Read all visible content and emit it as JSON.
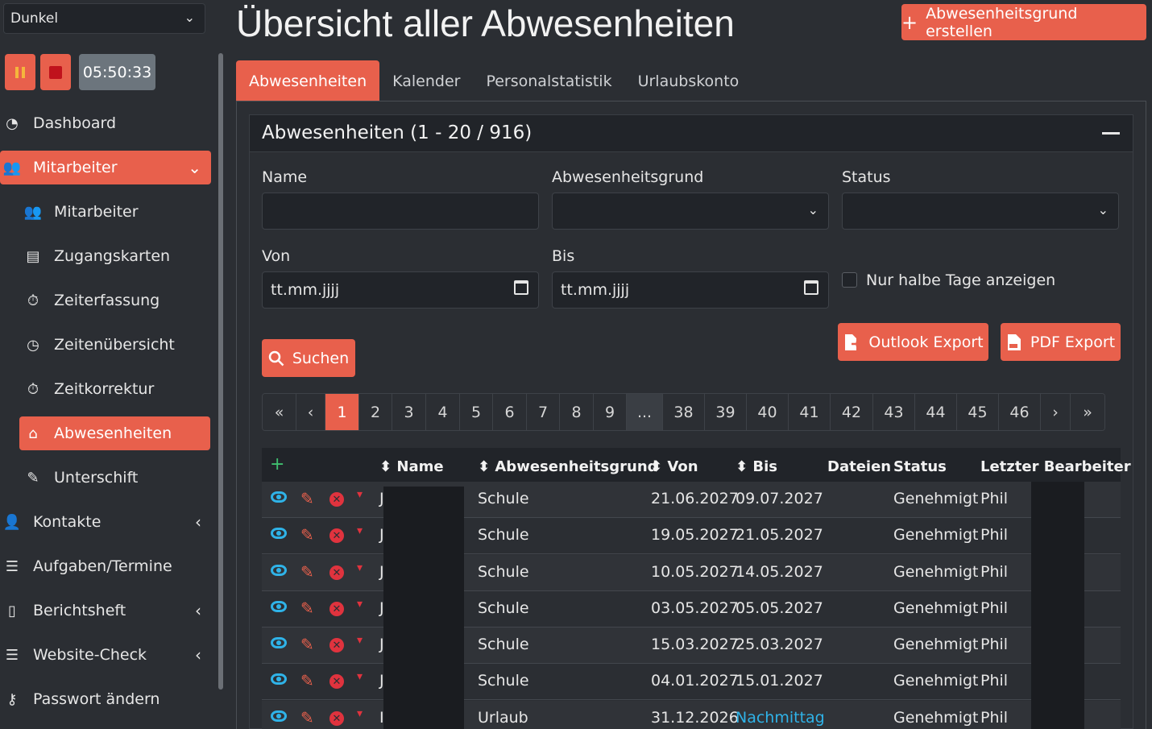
{
  "theme": {
    "selected": "Dunkel"
  },
  "timer": {
    "time": "05:50:33"
  },
  "nav": [
    {
      "label": "Dashboard",
      "icon": "dashboard-icon"
    },
    {
      "label": "Mitarbeiter",
      "icon": "users-icon",
      "active": true
    },
    {
      "label": "Mitarbeiter",
      "icon": "users-icon"
    },
    {
      "label": "Zugangskarten",
      "icon": "id-card-icon"
    },
    {
      "label": "Zeiterfassung",
      "icon": "stopwatch-icon"
    },
    {
      "label": "Zeitenübersicht",
      "icon": "clock-icon"
    },
    {
      "label": "Zeitkorrektur",
      "icon": "stopwatch-icon"
    },
    {
      "label": "Abwesenheiten",
      "icon": "house-icon",
      "active": true
    },
    {
      "label": "Unterschift",
      "icon": "signature-icon"
    },
    {
      "label": "Kontakte",
      "icon": "contact-icon"
    },
    {
      "label": "Aufgaben/Termine",
      "icon": "tasks-icon"
    },
    {
      "label": "Berichtsheft",
      "icon": "book-icon"
    },
    {
      "label": "Website-Check",
      "icon": "tasks-icon"
    },
    {
      "label": "Passwort ändern",
      "icon": "key-icon"
    }
  ],
  "header": {
    "title": "Übersicht aller Abwesenheiten",
    "create_label": "Abwesenheitsgrund erstellen"
  },
  "tabs": [
    "Abwesenheiten",
    "Kalender",
    "Personalstatistik",
    "Urlaubskonto"
  ],
  "card": {
    "title": "Abwesenheiten (1 - 20 / 916)"
  },
  "filters": {
    "name_label": "Name",
    "name_value": "",
    "grund_label": "Abwesenheitsgrund",
    "status_label": "Status",
    "von_label": "Von",
    "von_value": "tt.mm.jjjj",
    "bis_label": "Bis",
    "bis_value": "tt.mm.jjjj",
    "halbe_tage_label": "Nur halbe Tage anzeigen"
  },
  "buttons": {
    "outlook": "Outlook Export",
    "pdf": "PDF Export",
    "search": "Suchen"
  },
  "pagination": [
    "«",
    "‹",
    "1",
    "2",
    "3",
    "4",
    "5",
    "6",
    "7",
    "8",
    "9",
    "...",
    "38",
    "39",
    "40",
    "41",
    "42",
    "43",
    "44",
    "45",
    "46",
    "›",
    "»"
  ],
  "table": {
    "add": "+",
    "columns": [
      "Name",
      "Abwesenheitsgrund",
      "Von",
      "Bis",
      "Dateien",
      "Status",
      "Letzter Bearbeiter"
    ],
    "rows": [
      {
        "name": "J",
        "grund": "Schule",
        "von": "21.06.2027",
        "bis": "09.07.2027",
        "status": "Genehmigt",
        "bearbeiter": "Phil"
      },
      {
        "name": "J",
        "grund": "Schule",
        "von": "19.05.2027",
        "bis": "21.05.2027",
        "status": "Genehmigt",
        "bearbeiter": "Phil"
      },
      {
        "name": "J",
        "grund": "Schule",
        "von": "10.05.2027",
        "bis": "14.05.2027",
        "status": "Genehmigt",
        "bearbeiter": "Phil"
      },
      {
        "name": "J",
        "grund": "Schule",
        "von": "03.05.2027",
        "bis": "05.05.2027",
        "status": "Genehmigt",
        "bearbeiter": "Phil"
      },
      {
        "name": "J",
        "grund": "Schule",
        "von": "15.03.2027",
        "bis": "25.03.2027",
        "status": "Genehmigt",
        "bearbeiter": "Phil"
      },
      {
        "name": "J",
        "grund": "Schule",
        "von": "04.01.2027",
        "bis": "15.01.2027",
        "status": "Genehmigt",
        "bearbeiter": "Phil"
      },
      {
        "name": "I",
        "grund": "Urlaub",
        "von": "31.12.2026",
        "bis": "Nachmittag",
        "status": "Genehmigt",
        "bearbeiter": "Phil"
      }
    ]
  }
}
